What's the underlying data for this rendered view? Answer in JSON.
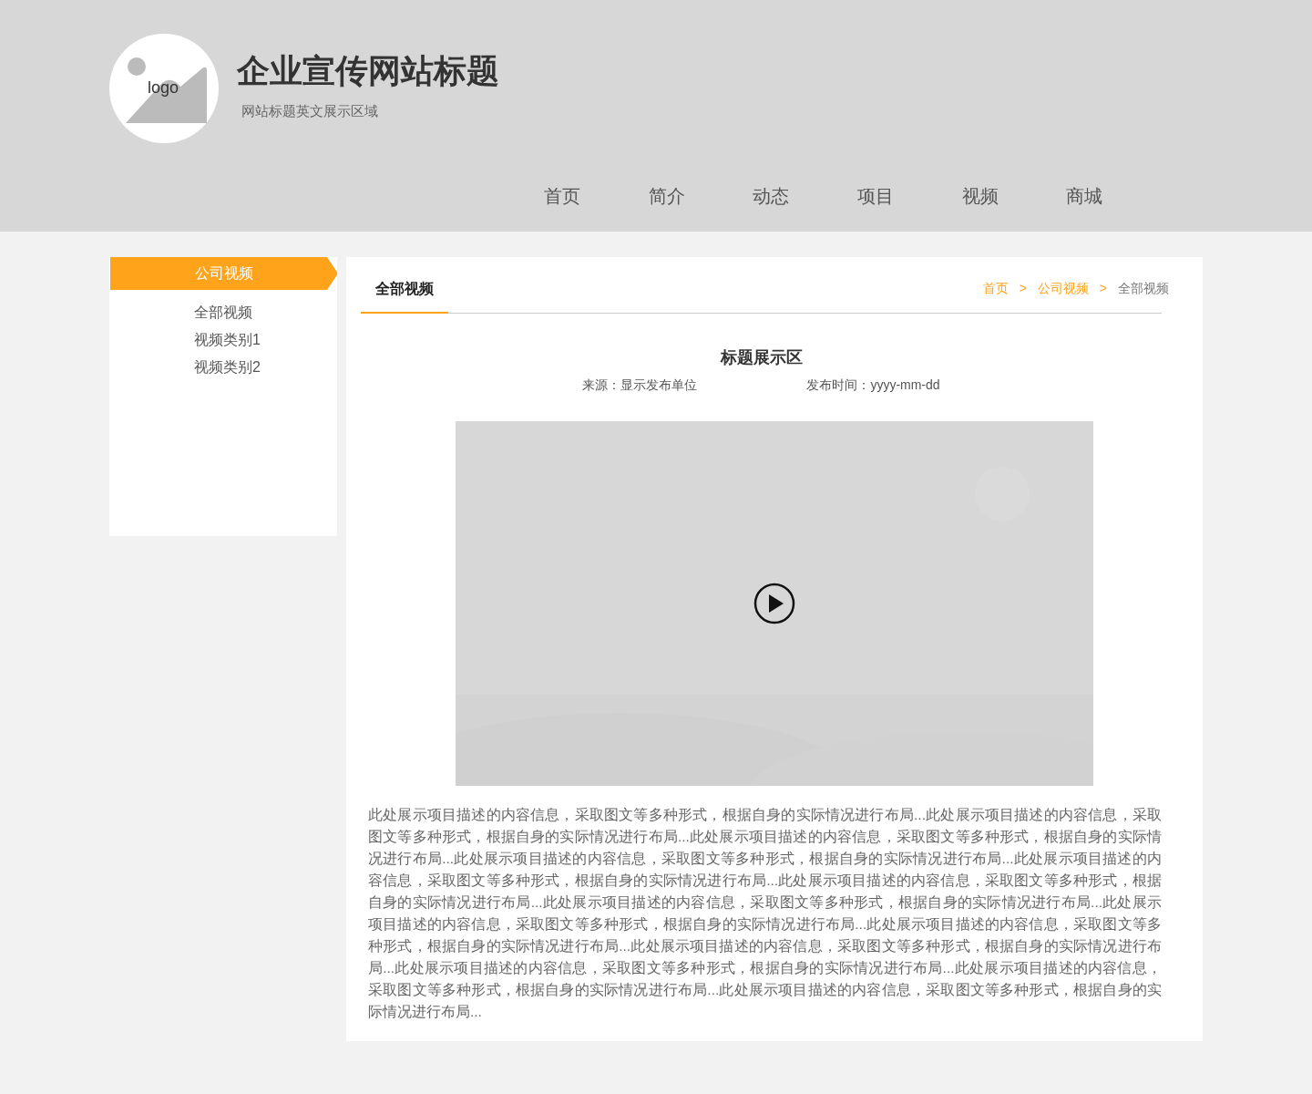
{
  "header": {
    "logo_text": "logo",
    "title": "企业宣传网站标题",
    "subtitle": "网站标题英文展示区域"
  },
  "nav": [
    {
      "label": "首页",
      "selected": false
    },
    {
      "label": "简介",
      "selected": false
    },
    {
      "label": "动态",
      "selected": false
    },
    {
      "label": "项目",
      "selected": false
    },
    {
      "label": "视频",
      "selected": false
    },
    {
      "label": "商城",
      "selected": false
    }
  ],
  "sidebar": {
    "heading": "公司视频",
    "items": [
      {
        "label": "全部视频",
        "selected": false
      },
      {
        "label": "视频类别1",
        "selected": false
      },
      {
        "label": "视频类别2",
        "selected": false
      }
    ]
  },
  "main": {
    "tab": {
      "label": "全部视频",
      "selected": true
    },
    "breadcrumb": [
      {
        "label": "首页",
        "kind": "link"
      },
      {
        "label": "公司视频",
        "kind": "link"
      },
      {
        "label": "全部视频",
        "kind": "current"
      }
    ],
    "separator": ">",
    "article": {
      "title": "标题展示区",
      "source": "来源：显示发布单位",
      "date": "发布时间：yyyy-mm-dd",
      "body": "此处展示项目描述的内容信息，采取图文等多种形式，根据自身的实际情况进行布局...此处展示项目描述的内容信息，采取图文等多种形式，根据自身的实际情况进行布局...此处展示项目描述的内容信息，采取图文等多种形式，根据自身的实际情况进行布局...此处展示项目描述的内容信息，采取图文等多种形式，根据自身的实际情况进行布局...此处展示项目描述的内容信息，采取图文等多种形式，根据自身的实际情况进行布局...此处展示项目描述的内容信息，采取图文等多种形式，根据自身的实际情况进行布局...此处展示项目描述的内容信息，采取图文等多种形式，根据自身的实际情况进行布局...此处展示项目描述的内容信息，采取图文等多种形式，根据自身的实际情况进行布局...此处展示项目描述的内容信息，采取图文等多种形式，根据自身的实际情况进行布局...此处展示项目描述的内容信息，采取图文等多种形式，根据自身的实际情况进行布局...此处展示项目描述的内容信息，采取图文等多种形式，根据自身的实际情况进行布局...此处展示项目描述的内容信息，采取图文等多种形式，根据自身的实际情况进行布局...此处展示项目描述的内容信息，采取图文等多种形式，根据自身的实际情况进行布局..."
    }
  }
}
